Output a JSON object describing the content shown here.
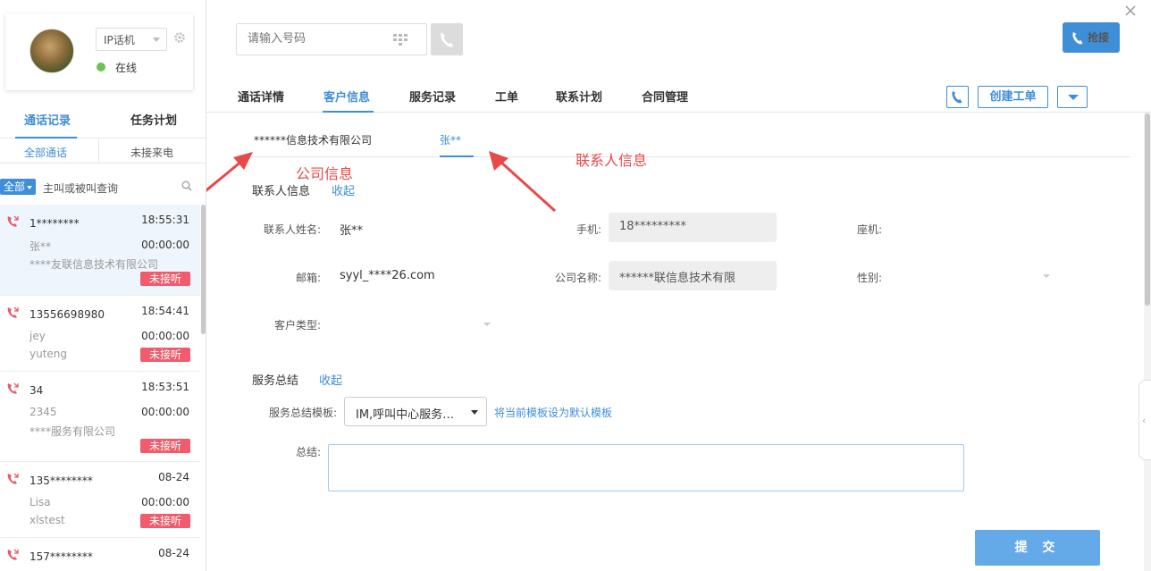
{
  "agent": {
    "device": "IP话机",
    "status": "在线"
  },
  "left_tabs": [
    "通话记录",
    "任务计划"
  ],
  "sub_tabs": [
    "全部通话",
    "未接来电"
  ],
  "filter": {
    "scope": "全部",
    "placeholder": "主叫或被叫查询"
  },
  "calls": [
    {
      "number": "1********",
      "time": "18:55:31",
      "name": "张**",
      "duration": "00:00:00",
      "company": "****友联信息技术有限公司",
      "badge": "未接听"
    },
    {
      "number": "13556698980",
      "time": "18:54:41",
      "name": "jey",
      "duration": "00:00:00",
      "company": "yuteng",
      "badge": "未接听"
    },
    {
      "number": "34",
      "time": "18:53:51",
      "name": "2345",
      "duration": "00:00:00",
      "company": "****服务有限公司",
      "badge": "未接听"
    },
    {
      "number": "135********",
      "time": "08-24",
      "name": "Lisa",
      "duration": "00:00:00",
      "company": "xlstest",
      "badge": "未接听"
    },
    {
      "number": "157********",
      "time": "08-24",
      "name": "",
      "duration": "",
      "company": "",
      "badge": ""
    }
  ],
  "dialer": {
    "placeholder": "请输入号码",
    "grab_label": "抢接"
  },
  "tabs": [
    "通话详情",
    "客户信息",
    "服务记录",
    "工单",
    "联系计划",
    "合同管理"
  ],
  "actions": {
    "create_ticket": "创建工单"
  },
  "customer": {
    "company_tab": "******信息技术有限公司",
    "contact_tab": "张**"
  },
  "annotations": {
    "company": "公司信息",
    "contact": "联系人信息"
  },
  "contact_section": {
    "title": "联系人信息",
    "collapse": "收起",
    "name_label": "联系人姓名:",
    "name_value": "张**",
    "mobile_label": "手机:",
    "mobile_value": "18*********",
    "phone_label": "座机:",
    "email_label": "邮箱:",
    "email_value": "syyl_****26.com",
    "company_label": "公司名称:",
    "company_value": "******联信息技术有限",
    "gender_label": "性别:",
    "type_label": "客户类型:"
  },
  "summary_section": {
    "title": "服务总结",
    "collapse": "收起",
    "template_label": "服务总结模板:",
    "template_value": "IM,呼叫中心服务…",
    "set_default": "将当前模板设为默认模板",
    "summary_label": "总结:",
    "submit": "提 交"
  },
  "colors": {
    "accent": "#3f8ed8",
    "badge_red": "#f05c6c",
    "annotation_red": "#e84a4a"
  }
}
